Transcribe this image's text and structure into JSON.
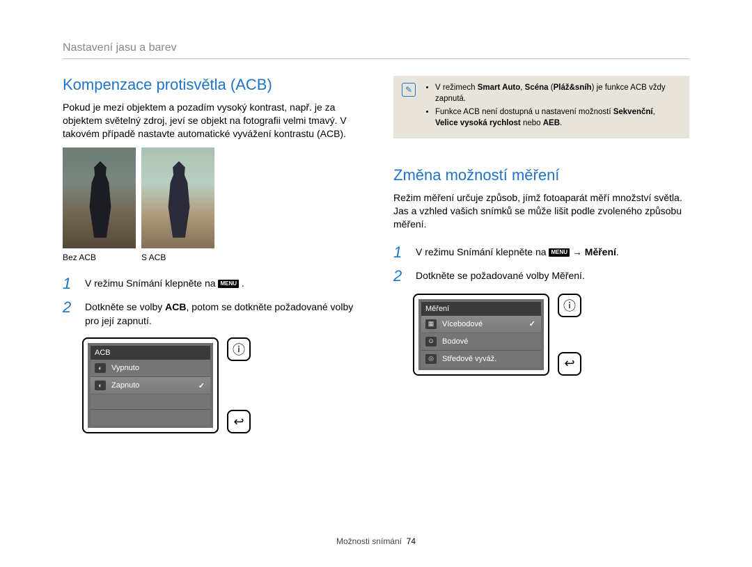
{
  "breadcrumb": "Nastavení jasu a barev",
  "left": {
    "heading": "Kompenzace protisvětla (ACB)",
    "intro": "Pokud je mezi objektem a pozadím vysoký kontrast, např. je za objektem světelný zdroj, jeví se objekt na fotografii velmi tmavý. V takovém případě nastavte automatické vyvážení kontrastu (ACB).",
    "caption_off": "Bez ACB",
    "caption_on": "S ACB",
    "step1_pre": "V režimu Snímání klepněte na ",
    "step1_post": " .",
    "step2_a": "Dotkněte se volby ",
    "step2_bold": "ACB",
    "step2_b": ", potom se dotkněte požadované volby pro její zapnutí.",
    "ui": {
      "title": "ACB",
      "opt_off": "Vypnuto",
      "opt_on": "Zapnuto"
    }
  },
  "note": {
    "line1_a": "V režimech ",
    "line1_b1": "Smart Auto",
    "line1_b2": ", ",
    "line1_b3": "Scéna",
    "line1_b4": " (",
    "line1_b5": "Pláž&sníh",
    "line1_b6": ") je funkce ACB vždy zapnutá.",
    "line2_a": "Funkce ACB není dostupná u nastavení možností ",
    "line2_b1": "Sekvenční",
    "line2_b2": ", ",
    "line2_b3": "Velice vysoká rychlost",
    "line2_b4": " nebo ",
    "line2_b5": "AEB",
    "line2_b6": "."
  },
  "right": {
    "heading": "Změna možností měření",
    "intro": "Režim měření určuje způsob, jímž fotoaparát měří množství světla. Jas a vzhled vašich snímků se může lišit podle zvoleného způsobu měření.",
    "step1_pre": "V režimu Snímání klepněte na ",
    "step1_arrow": " → ",
    "step1_bold": "Měření",
    "step1_post": ".",
    "step2": "Dotkněte se požadované volby Měření.",
    "ui": {
      "title": "Měření",
      "opt_multi": "Vícebodové",
      "opt_spot": "Bodové",
      "opt_center": "Středově vyváž."
    }
  },
  "menu_label": "MENU",
  "footer_section": "Možnosti snímání",
  "footer_page": "74"
}
